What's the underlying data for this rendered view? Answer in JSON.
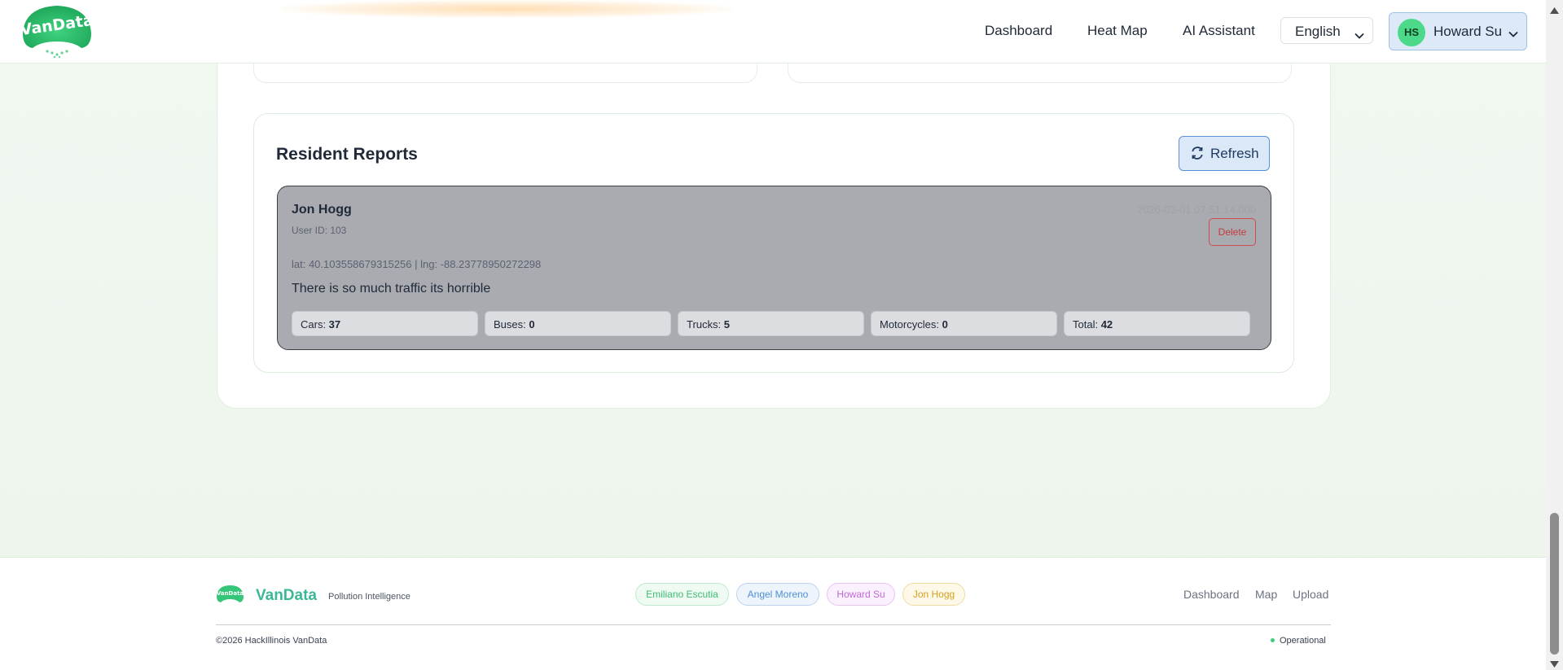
{
  "header": {
    "logo_text": "VanData",
    "nav": [
      "Dashboard",
      "Heat Map",
      "AI Assistant"
    ],
    "language": "English",
    "user": {
      "initials": "HS",
      "name": "Howard Su"
    }
  },
  "reports": {
    "title": "Resident Reports",
    "refresh_label": "Refresh",
    "items": [
      {
        "name": "Jon Hogg",
        "user_id": "User ID: 103",
        "timestamp": "2026-03-01 07:51:14.000",
        "delete_label": "Delete",
        "coords": "lat: 40.103558679315256 | lng: -88.23778950272298",
        "message": "There is so much traffic its horrible",
        "counts": [
          {
            "label": "Cars: ",
            "value": "37"
          },
          {
            "label": "Buses: ",
            "value": "0"
          },
          {
            "label": "Trucks: ",
            "value": "5"
          },
          {
            "label": "Motorcycles: ",
            "value": "0"
          },
          {
            "label": "Total: ",
            "value": "42"
          }
        ]
      }
    ]
  },
  "footer": {
    "brand": "VanData",
    "tagline": "Pollution Intelligence",
    "team": [
      {
        "name": "Emiliano Escutia",
        "color": "#3fbf73",
        "bg": "#eefaf2",
        "border": "#bfe8cd"
      },
      {
        "name": "Angel Moreno",
        "color": "#4f8fd6",
        "bg": "#eef4fc",
        "border": "#bcd3ef"
      },
      {
        "name": "Howard Su",
        "color": "#c06ad6",
        "bg": "#fbf0fd",
        "border": "#e6c6ef"
      },
      {
        "name": "Jon Hogg",
        "color": "#d4a21e",
        "bg": "#fdf8e8",
        "border": "#efdca3"
      }
    ],
    "links": [
      "Dashboard",
      "Map",
      "Upload"
    ],
    "copyright": "©2026 HackIllinois VanData",
    "status": "Operational"
  }
}
